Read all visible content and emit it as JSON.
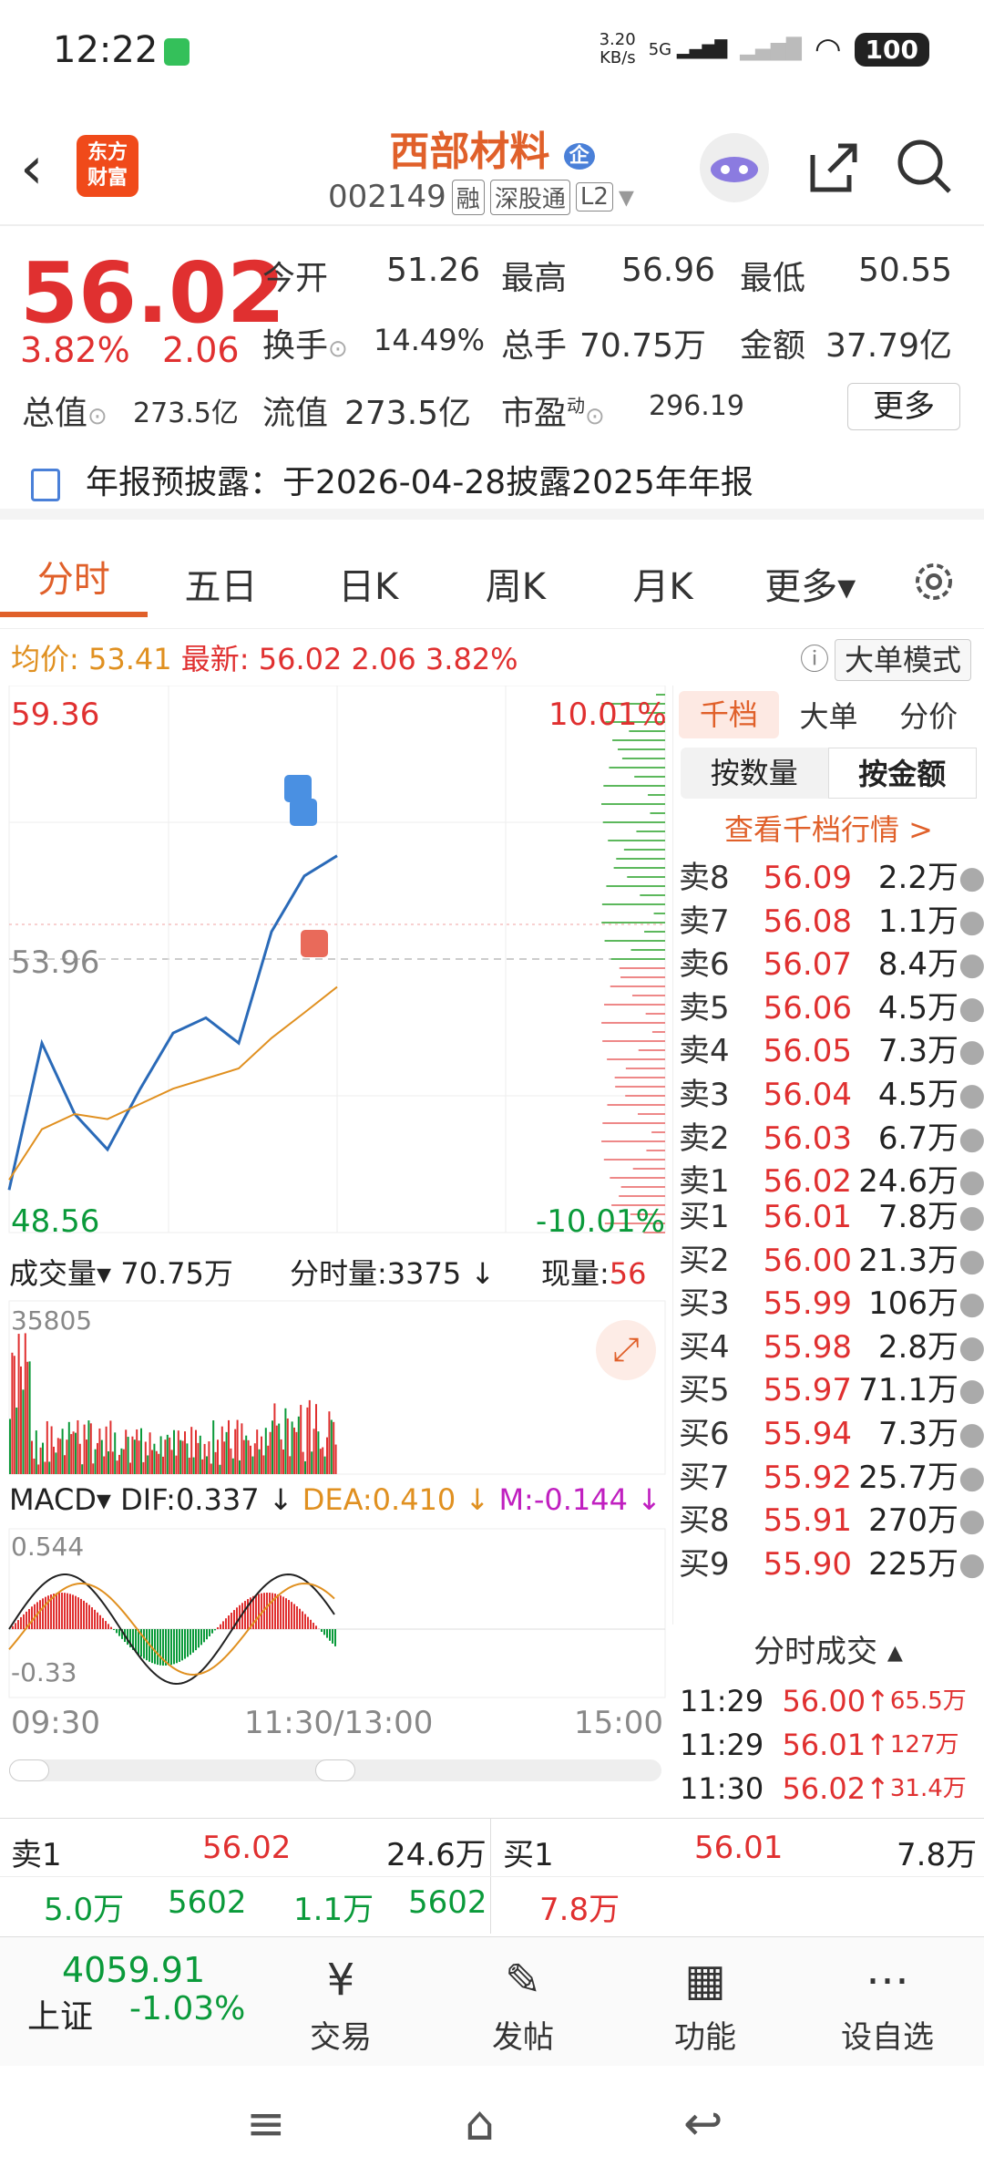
{
  "status": {
    "time": "12:22",
    "speed": "3.20\nKB/s",
    "battery": "100",
    "network": "5G"
  },
  "header": {
    "title": "西部材料",
    "title_badge": "企",
    "code": "002149",
    "tags": [
      "融",
      "深股通",
      "L2"
    ]
  },
  "quote": {
    "price": "56.02",
    "change_pct": "3.82%",
    "change": "2.06",
    "open_label": "今开",
    "open": "51.26",
    "high_label": "最高",
    "high": "56.96",
    "low_label": "最低",
    "low": "50.55",
    "turnover_label": "换手",
    "turnover": "14.49%",
    "volume_label": "总手",
    "volume": "70.75万",
    "amount_label": "金额",
    "amount": "37.79亿",
    "mktcap_label": "总值",
    "mktcap": "273.5亿",
    "float_label": "流值",
    "float": "273.5亿",
    "pe_label": "市盈",
    "pe_sup": "动",
    "pe": "296.19",
    "more": "更多"
  },
  "notice": {
    "text": "年报预披露：于2026-04-28披露2025年年报"
  },
  "tabs": [
    "分时",
    "五日",
    "日K",
    "周K",
    "月K",
    "更多▾"
  ],
  "avgbar": {
    "avg_label": "均价:",
    "avg": "53.41",
    "latest_label": "最新:",
    "latest": "56.02",
    "chg": "2.06",
    "pct": "3.82%",
    "mode_btn": "大单模式"
  },
  "chart": {
    "top_price": "59.36",
    "top_pct": "10.01%",
    "mid_price": "53.96",
    "bottom_price": "48.56",
    "bottom_pct": "-10.01%",
    "vol_label": "成交量▾",
    "vol_total": "70.75万",
    "vol_seg_label": "分时量:3375 ↓",
    "vol_now": "现量:56",
    "vol_max": "35805",
    "macd_label": "MACD▾",
    "dif": "DIF:0.337 ↓",
    "dea": "DEA:0.410 ↓",
    "m": "M:-0.144 ↓",
    "macd_top": "0.544",
    "macd_bottom": "-0.33",
    "times": [
      "09:30",
      "11:30/13:00",
      "15:00"
    ],
    "marker_s": "S",
    "marker_b": "B"
  },
  "chart_data": {
    "type": "line",
    "x": [
      "09:30",
      "09:45",
      "10:00",
      "10:15",
      "10:30",
      "10:45",
      "11:00",
      "11:15",
      "11:30",
      "13:00",
      "13:05"
    ],
    "series": [
      {
        "values": [
          49.4,
          52.3,
          50.9,
          50.2,
          51.4,
          52.5,
          52.8,
          52.3,
          54.5,
          55.6,
          56.0
        ]
      },
      {
        "values": [
          49.6,
          50.6,
          50.9,
          50.8,
          51.1,
          51.4,
          51.6,
          51.8,
          52.4,
          52.9,
          53.41
        ]
      }
    ],
    "ylim": [
      48.56,
      59.36
    ]
  },
  "orderbook": {
    "tabs": [
      "千档",
      "大单",
      "分价"
    ],
    "toggle": [
      "按数量",
      "按金额"
    ],
    "link": "查看千档行情 >",
    "asks": [
      {
        "label": "卖8",
        "price": "56.09",
        "vol": "2.2万"
      },
      {
        "label": "卖7",
        "price": "56.08",
        "vol": "1.1万"
      },
      {
        "label": "卖6",
        "price": "56.07",
        "vol": "8.4万"
      },
      {
        "label": "卖5",
        "price": "56.06",
        "vol": "4.5万"
      },
      {
        "label": "卖4",
        "price": "56.05",
        "vol": "7.3万"
      },
      {
        "label": "卖3",
        "price": "56.04",
        "vol": "4.5万"
      },
      {
        "label": "卖2",
        "price": "56.03",
        "vol": "6.7万"
      },
      {
        "label": "卖1",
        "price": "56.02",
        "vol": "24.6万"
      }
    ],
    "bids": [
      {
        "label": "买1",
        "price": "56.01",
        "vol": "7.8万"
      },
      {
        "label": "买2",
        "price": "56.00",
        "vol": "21.3万"
      },
      {
        "label": "买3",
        "price": "55.99",
        "vol": "106万"
      },
      {
        "label": "买4",
        "price": "55.98",
        "vol": "2.8万"
      },
      {
        "label": "买5",
        "price": "55.97",
        "vol": "71.1万"
      },
      {
        "label": "买6",
        "price": "55.94",
        "vol": "7.3万"
      },
      {
        "label": "买7",
        "price": "55.92",
        "vol": "25.7万"
      },
      {
        "label": "买8",
        "price": "55.91",
        "vol": "270万"
      },
      {
        "label": "买9",
        "price": "55.90",
        "vol": "225万"
      }
    ]
  },
  "ticks": {
    "head": "分时成交 ▴",
    "rows": [
      {
        "t": "11:29",
        "p": "56.00↑",
        "v": "65.5万"
      },
      {
        "t": "11:29",
        "p": "56.01↑",
        "v": "127万"
      },
      {
        "t": "11:30",
        "p": "56.02↑",
        "v": "31.4万"
      }
    ]
  },
  "level1": {
    "sell_label": "卖1",
    "sell_price": "56.02",
    "sell_vol": "24.6万",
    "buy_label": "买1",
    "buy_price": "56.01",
    "buy_vol": "7.8万",
    "row2": [
      "5.0万",
      "5602",
      "1.1万",
      "5602",
      "7.8万"
    ]
  },
  "bottombar": {
    "index_value": "4059.91",
    "index_name": "上证",
    "index_pct": "-1.03%",
    "items": [
      "交易",
      "发帖",
      "功能",
      "设自选"
    ]
  }
}
